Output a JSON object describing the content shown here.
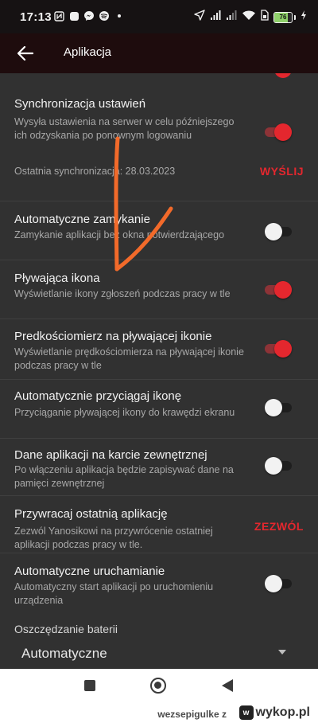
{
  "status_bar": {
    "time": "17:13",
    "battery_percent": 76,
    "battery_label": "76",
    "left_icons": [
      "nfc-icon",
      "notification-square-icon",
      "messenger-icon",
      "spotify-icon",
      "dot-icon"
    ],
    "right_icons": [
      "location-arrow-icon",
      "signal-icon",
      "signal-icon-2",
      "wifi-icon",
      "sim-icon",
      "charging-icon"
    ]
  },
  "app_bar": {
    "title": "Aplikacja",
    "back_icon": "arrow-left-icon"
  },
  "settings": [
    {
      "title": "Synchronizacja ustawień",
      "subtitle": "Wysyła ustawienia na serwer w celu późniejszego ich odzyskania po ponownym logowaniu",
      "toggle_on": true
    },
    {
      "title": "Automatyczne zamykanie",
      "subtitle": "Zamykanie aplikacji bez okna potwierdzającego",
      "toggle_on": false
    },
    {
      "title": "Pływająca ikona",
      "subtitle": "Wyświetlanie ikony zgłoszeń podczas pracy w tle",
      "toggle_on": true
    },
    {
      "title": "Predkościomierz na pływającej ikonie",
      "subtitle": "Wyświetlanie prędkościomierza na pływającej ikonie podczas pracy w tle",
      "toggle_on": true
    },
    {
      "title": "Automatycznie przyciągaj ikonę",
      "subtitle": "Przyciąganie pływającej ikony do krawędzi ekranu",
      "toggle_on": false
    },
    {
      "title": "Dane aplikacji na karcie zewnętrznej",
      "subtitle": "Po włączeniu aplikacja będzie zapisywać dane na pamięci zewnętrznej",
      "toggle_on": false
    },
    {
      "title": "Przywracaj ostatnią aplikację",
      "subtitle": "Zezwól Yanosikowi na przywrócenie ostatniej aplikacji podczas pracy w tle.",
      "action": "ZEZWÓL"
    },
    {
      "title": "Automatyczne uruchamianie",
      "subtitle": "Automatyczny start aplikacji po uruchomieniu urządzenia",
      "toggle_on": false
    }
  ],
  "sync": {
    "info": "Ostatnia synchronizacja: 28.03.2023",
    "action": "WYŚLIJ"
  },
  "battery_saving": {
    "label": "Oszczędzanie baterii",
    "value": "Automatyczne"
  },
  "colors": {
    "accent": "#e4272e",
    "background": "#313131",
    "app_bar": "#1e0c0d",
    "annotation_arrow": "#f26a2a"
  },
  "footer": {
    "username": "wezsepigulke",
    "username_suffix": "z",
    "brand": "wykop.pl"
  }
}
